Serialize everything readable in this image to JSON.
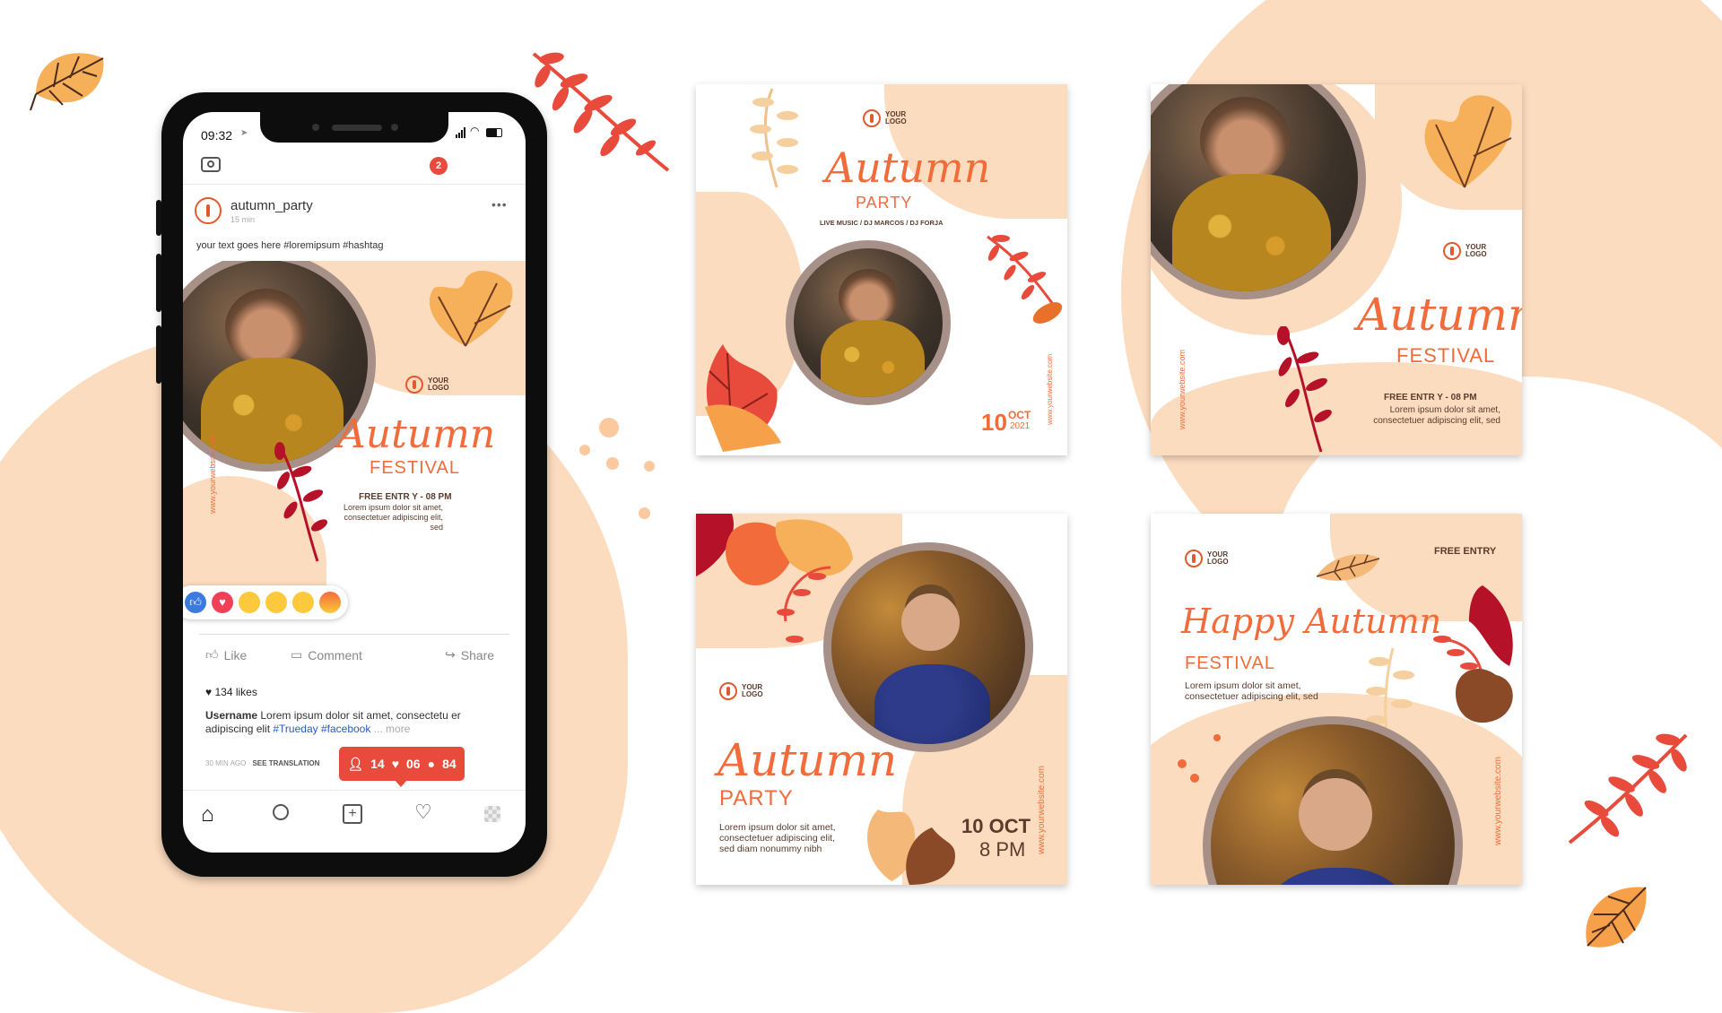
{
  "colors": {
    "accent": "#f26b3a",
    "peach": "#fcdcbf",
    "brown": "#5a3b2c",
    "red": "#e84b3c"
  },
  "phone": {
    "time": "09:32",
    "notif_count": "2",
    "account": "autumn_party",
    "account_meta": "15 min",
    "caption": "your text goes here #loremipsum #hashtag",
    "post": {
      "logo": "YOUR\nLOGO",
      "title": "Autumn",
      "subtitle": "FESTIVAL",
      "entry": "FREE ENTR Y -  08 PM",
      "desc": "Lorem ipsum dolor sit amet,\nconsectetuer adipiscing elit, sed",
      "website": "www.yourwebsite.com"
    },
    "actions": {
      "like": "Like",
      "comment": "Comment",
      "share": "Share"
    },
    "likes": "134 likes",
    "comment_user": "Username",
    "comment_text": " Lorem ipsum dolor sit amet, consectetu er adipiscing elit ",
    "hashtag1": "#Trueday",
    "hashtag2": "#facebook",
    "comment_more": "... more",
    "time_ago": "30 MIN AGO · ",
    "see_translation": "SEE TRANSLATION",
    "badge": {
      "followers": "14",
      "likes": "06",
      "comments": "84"
    },
    "reactions": [
      "like-icon",
      "love-icon",
      "haha-icon",
      "wow-icon",
      "sad-icon",
      "angry-icon"
    ]
  },
  "post1": {
    "logo": "YOUR\nLOGO",
    "title": "Autumn",
    "subtitle": "PARTY",
    "lineup": "LIVE MUSIC / DJ MARCOS / DJ FORJA",
    "day": "10",
    "month": "OCT",
    "year": "2021",
    "website": "www.yourwebsite.com"
  },
  "post2": {
    "logo": "YOUR\nLOGO",
    "title": "Autumn",
    "subtitle": "FESTIVAL",
    "entry": "FREE ENTR Y -  08 PM",
    "desc": "Lorem ipsum dolor sit amet,\nconsectetuer adipiscing elit, sed",
    "website": "www.yourwebsite.com"
  },
  "post3": {
    "logo": "YOUR\nLOGO",
    "title": "Autumn",
    "subtitle": "PARTY",
    "desc": "Lorem ipsum dolor sit amet,\nconsectetuer adipiscing elit,\nsed diam nonummy nibh",
    "date": "10 OCT",
    "time": "8 PM",
    "website": "www.yourwebsite.com"
  },
  "post4": {
    "logo": "YOUR\nLOGO",
    "free": "FREE ENTRY",
    "title": "Happy Autumn",
    "subtitle": "FESTIVAL",
    "desc": "Lorem ipsum dolor sit amet,\nconsectetuer adipiscing elit, sed",
    "website": "www.yourwebsite.com"
  }
}
